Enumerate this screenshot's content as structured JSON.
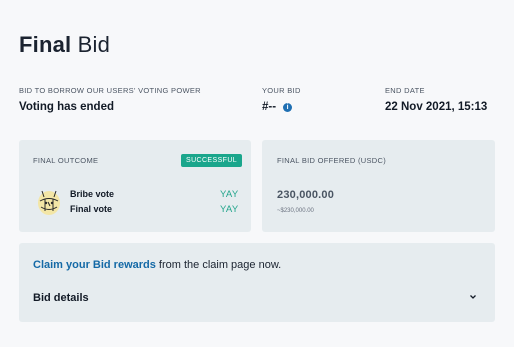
{
  "title": {
    "strong": "Final",
    "light": "Bid"
  },
  "meta": {
    "bid_label": "BID TO BORROW OUR USERS' VOTING POWER",
    "bid_value": "Voting has ended",
    "your_bid_label": "YOUR BID",
    "your_bid_value": "#--",
    "info_icon_glyph": "i",
    "end_date_label": "END DATE",
    "end_date_value": "22 Nov 2021, 15:13"
  },
  "outcome": {
    "label": "FINAL OUTCOME",
    "badge": "SUCCESSFUL",
    "badge_color": "#1aa68c",
    "avatar_icon": "bribe-avatar-icon",
    "rows": [
      {
        "label": "Bribe vote",
        "result": "YAY"
      },
      {
        "label": "Final vote",
        "result": "YAY"
      }
    ],
    "result_color": "#23a58c"
  },
  "offered": {
    "label": "FINAL BID OFFERED (USDC)",
    "amount": "230,000.00",
    "usd": "~$230,000.00"
  },
  "claim": {
    "link_text": "Claim your Bid rewards",
    "rest_text": " from the claim page now.",
    "link_color": "#1469a6"
  },
  "details": {
    "label": "Bid details",
    "icon": "chevron-down-icon"
  }
}
